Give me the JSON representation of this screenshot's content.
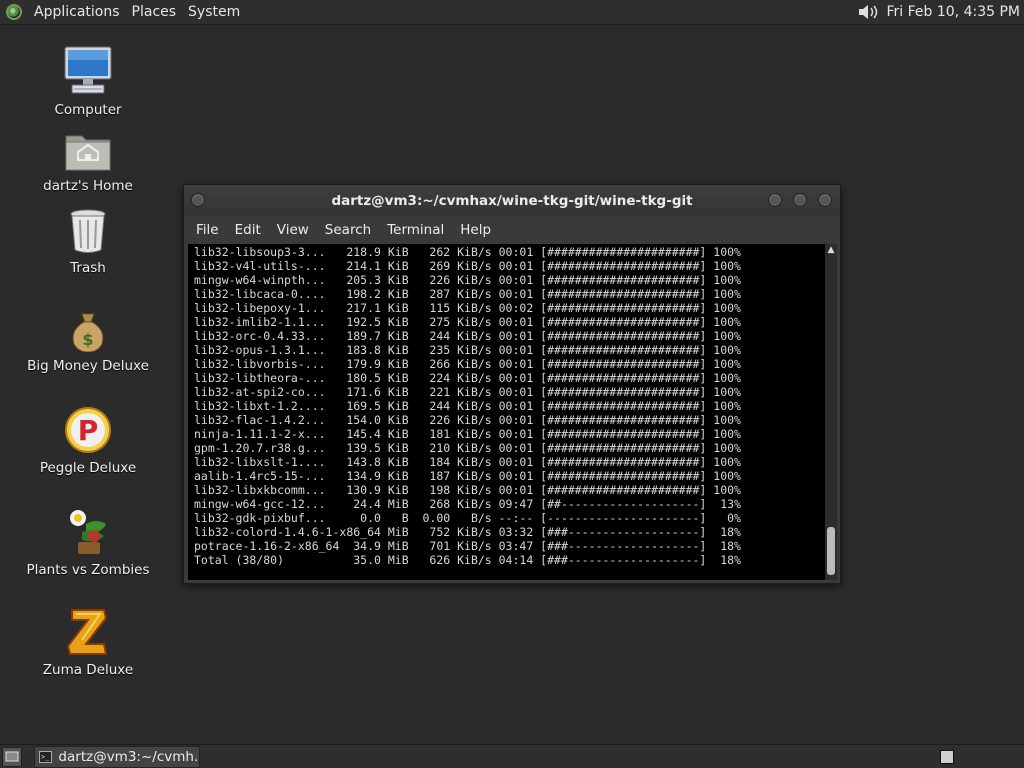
{
  "top_panel": {
    "menus": [
      "Applications",
      "Places",
      "System"
    ],
    "clock": "Fri Feb 10,  4:35 PM",
    "icons": {
      "logo": "distro-logo-icon",
      "volume": "volume-icon"
    }
  },
  "desktop": {
    "icons": [
      {
        "label": "Computer",
        "icon": "computer-icon"
      },
      {
        "label": "dartz's Home",
        "icon": "home-folder-icon"
      },
      {
        "label": "Trash",
        "icon": "trash-icon"
      },
      {
        "label": "Big Money Deluxe",
        "icon": "money-bag-icon"
      },
      {
        "label": "Peggle Deluxe",
        "icon": "peggle-icon"
      },
      {
        "label": "Plants vs Zombies",
        "icon": "plants-vs-zombies-icon"
      },
      {
        "label": "Zuma Deluxe",
        "icon": "zuma-icon"
      }
    ]
  },
  "terminal": {
    "title": "dartz@vm3:~/cvmhax/wine-tkg-git/wine-tkg-git",
    "menu": [
      "File",
      "Edit",
      "View",
      "Search",
      "Terminal",
      "Help"
    ],
    "lines": [
      "lib32-libsoup3-3...   218.9 KiB   262 KiB/s 00:01 [######################] 100%",
      "lib32-v4l-utils-...   214.1 KiB   269 KiB/s 00:01 [######################] 100%",
      "mingw-w64-winpth...   205.3 KiB   226 KiB/s 00:01 [######################] 100%",
      "lib32-libcaca-0....   198.2 KiB   287 KiB/s 00:01 [######################] 100%",
      "lib32-libepoxy-1...   217.1 KiB   115 KiB/s 00:02 [######################] 100%",
      "lib32-imlib2-1.1...   192.5 KiB   275 KiB/s 00:01 [######################] 100%",
      "lib32-orc-0.4.33...   189.7 KiB   244 KiB/s 00:01 [######################] 100%",
      "lib32-opus-1.3.1...   183.8 KiB   235 KiB/s 00:01 [######################] 100%",
      "lib32-libvorbis-...   179.9 KiB   266 KiB/s 00:01 [######################] 100%",
      "lib32-libtheora-...   180.5 KiB   224 KiB/s 00:01 [######################] 100%",
      "lib32-at-spi2-co...   171.6 KiB   221 KiB/s 00:01 [######################] 100%",
      "lib32-libxt-1.2....   169.5 KiB   244 KiB/s 00:01 [######################] 100%",
      "lib32-flac-1.4.2...   154.0 KiB   226 KiB/s 00:01 [######################] 100%",
      "ninja-1.11.1-2-x...   145.4 KiB   181 KiB/s 00:01 [######################] 100%",
      "gpm-1.20.7.r38.g...   139.5 KiB   210 KiB/s 00:01 [######################] 100%",
      "lib32-libxslt-1....   143.8 KiB   184 KiB/s 00:01 [######################] 100%",
      "aalib-1.4rc5-15-...   134.9 KiB   187 KiB/s 00:01 [######################] 100%",
      "lib32-libxkbcomm...   130.9 KiB   198 KiB/s 00:01 [######################] 100%",
      "mingw-w64-gcc-12...    24.4 MiB   268 KiB/s 09:47 [##--------------------]  13%",
      "lib32-gdk-pixbuf...     0.0   B  0.00   B/s --:-- [----------------------]   0%",
      "lib32-colord-1.4.6-1-x86_64 MiB   752 KiB/s 03:32 [###-------------------]  18%",
      "potrace-1.16-2-x86_64  34.9 MiB   701 KiB/s 03:47 [###-------------------]  18%",
      "Total (38/80)          35.0 MiB   626 KiB/s 04:14 [###-------------------]  18%"
    ]
  },
  "bottom_panel": {
    "task_label": "dartz@vm3:~/cvmh...",
    "icons": {
      "show_desktop": "show-desktop-icon",
      "task": "terminal-icon",
      "workspace": "workspace-switcher-icon"
    }
  }
}
